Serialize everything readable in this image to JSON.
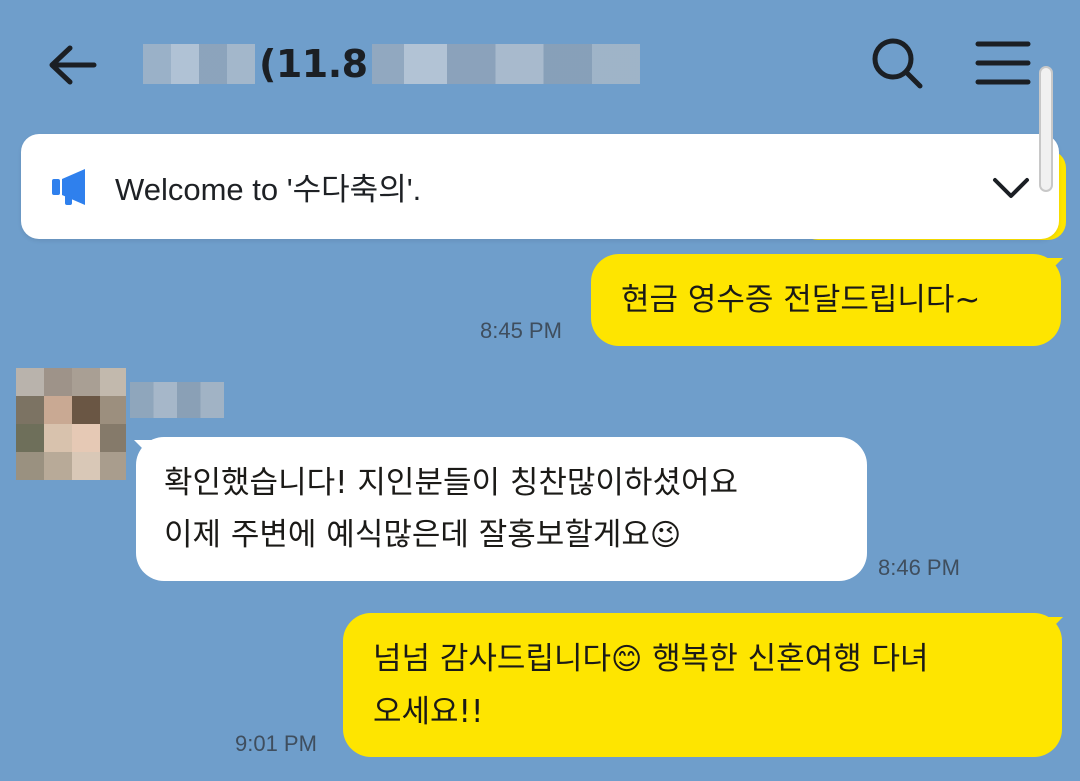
{
  "header": {
    "back_icon": "arrow-left-icon",
    "title_visible": "(11.8",
    "search_icon": "search-icon",
    "menu_icon": "hamburger-menu-icon"
  },
  "notice": {
    "icon": "megaphone-icon",
    "text": "Welcome to '수다축의'.",
    "chevron_icon": "chevron-down-icon"
  },
  "messages": [
    {
      "direction": "out",
      "text": "현금 영수증 전달드립니다~",
      "time": "8:45 PM"
    },
    {
      "direction": "in",
      "line1": "확인했습니다! 지인분들이 칭찬많이하셨어요",
      "line2": "이제 주변에 예식많은데 잘홍보할게요",
      "emoji": "😉",
      "time": "8:46 PM"
    },
    {
      "direction": "out",
      "line1_a": "넘넘 감사드립니다",
      "emoji": "😊",
      "line1_b": " 행복한 신혼여행 다녀",
      "line2": "오세요!!",
      "time": "9:01 PM"
    }
  ],
  "colors": {
    "background": "#6f9ecb",
    "outgoing_bubble": "#fee500",
    "incoming_bubble": "#ffffff",
    "notice_icon": "#2f80ed"
  }
}
